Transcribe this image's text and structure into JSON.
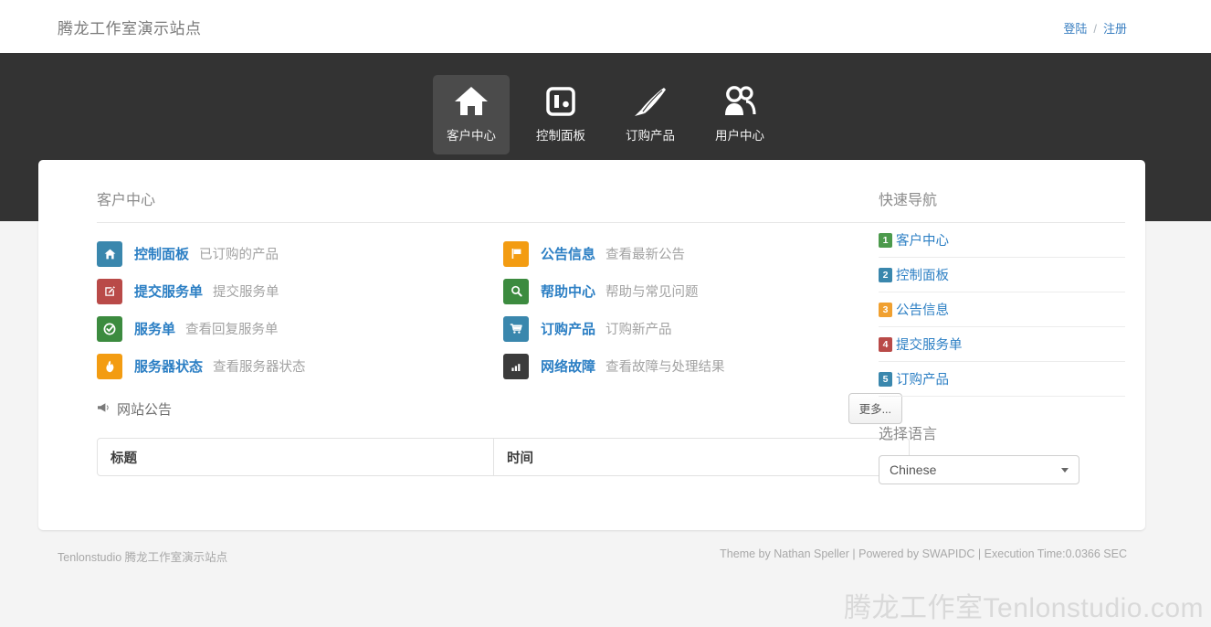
{
  "header": {
    "brand": "腾龙工作室演示站点",
    "login_label": "登陆",
    "separator": "/",
    "register_label": "注册"
  },
  "nav": {
    "items": [
      {
        "label": "客户中心",
        "icon": "home-icon",
        "active": true
      },
      {
        "label": "控制面板",
        "icon": "dashboard-icon",
        "active": false
      },
      {
        "label": "订购产品",
        "icon": "quill-pen-icon",
        "active": false
      },
      {
        "label": "用户中心",
        "icon": "users-icon",
        "active": false
      }
    ]
  },
  "main": {
    "section_title": "客户中心",
    "shortcuts": [
      {
        "title": "控制面板",
        "desc": "已订购的产品",
        "icon": "home-icon",
        "color": "#3a87ad"
      },
      {
        "title": "公告信息",
        "desc": "查看最新公告",
        "icon": "flag-icon",
        "color": "#f39c12"
      },
      {
        "title": "提交服务单",
        "desc": "提交服务单",
        "icon": "edit-icon",
        "color": "#b94a48"
      },
      {
        "title": "帮助中心",
        "desc": "帮助与常见问题",
        "icon": "search-icon",
        "color": "#3c8b3f"
      },
      {
        "title": "服务单",
        "desc": "查看回复服务单",
        "icon": "check-icon",
        "color": "#3c8b3f"
      },
      {
        "title": "订购产品",
        "desc": "订购新产品",
        "icon": "cart-icon",
        "color": "#3a87ad"
      },
      {
        "title": "服务器状态",
        "desc": "查看服务器状态",
        "icon": "fire-icon",
        "color": "#f39c12"
      },
      {
        "title": "网络故障",
        "desc": "查看故障与处理结果",
        "icon": "bar-chart-icon",
        "color": "#3b3b3b"
      }
    ],
    "announcements": {
      "title": "网站公告",
      "icon": "megaphone-icon",
      "more_label": "更多...",
      "columns": [
        "标题",
        "时间"
      ],
      "rows": []
    }
  },
  "sidebar": {
    "quicknav_title": "快速导航",
    "quicknav_items": [
      {
        "num": "1",
        "label": "客户中心",
        "color": "#4c9a4c"
      },
      {
        "num": "2",
        "label": "控制面板",
        "color": "#3a87ad"
      },
      {
        "num": "3",
        "label": "公告信息",
        "color": "#f0a030"
      },
      {
        "num": "4",
        "label": "提交服务单",
        "color": "#b94a48"
      },
      {
        "num": "5",
        "label": "订购产品",
        "color": "#3a87ad"
      }
    ],
    "language_title": "选择语言",
    "language_value": "Chinese",
    "language_options": [
      "Chinese"
    ]
  },
  "footer": {
    "left": "Tenlonstudio 腾龙工作室演示站点",
    "right": "Theme by Nathan Speller | Powered by SWAPIDC | Execution Time:0.0366 SEC",
    "watermark": "腾龙工作室Tenlonstudio.com"
  }
}
